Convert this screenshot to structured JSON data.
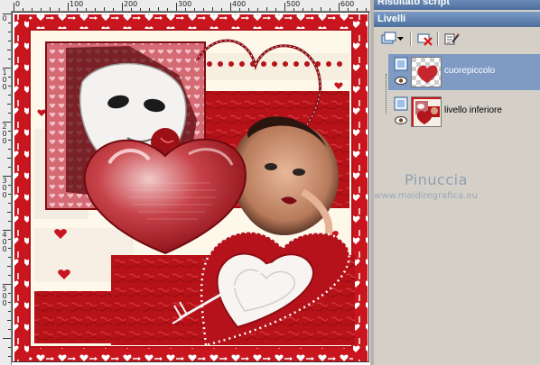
{
  "panels": {
    "script_caption": "Risultato script",
    "layers_caption": "Livelli"
  },
  "ruler": {
    "top_ticks": [
      "0",
      "100",
      "200",
      "300",
      "400",
      "500",
      "600"
    ],
    "left_ticks": [
      "0",
      "1\n0\n0",
      "2\n0\n0",
      "3\n0\n0",
      "4\n0\n0",
      "5\n0\n0"
    ]
  },
  "toolbar": {
    "new_layer_icon": "new-raster-layer-icon",
    "delete_layer_icon": "delete-layer-icon",
    "layer_properties_icon": "layer-properties-icon"
  },
  "layers": [
    {
      "name": "cuorepiccolo",
      "selected": true
    },
    {
      "name": "livello inferiore",
      "selected": false
    }
  ],
  "watermark": {
    "name": "Pinuccia",
    "site": "www.maidiregrafica.eu"
  },
  "colors": {
    "accent_red": "#b5121b",
    "dark_red": "#8b0d12",
    "panel_bg": "#d4d0c8",
    "selection": "#7f9bc4",
    "caption_blue": "#4e6f9d"
  }
}
